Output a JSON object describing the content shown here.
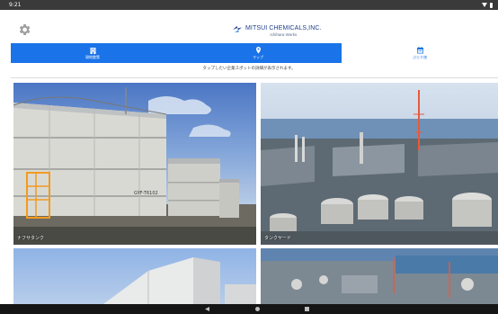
{
  "status_bar": {
    "time": "9:21"
  },
  "header": {
    "settings_icon": "gear-icon",
    "logo": {
      "name": "MITSUI CHEMICALS,INC.",
      "subtitle": "Ichihara Works",
      "icon": "mitsui-logo-icon"
    }
  },
  "tabs": [
    {
      "label": "現地散策",
      "icon": "building-icon",
      "active": true
    },
    {
      "label": "マップ",
      "icon": "map-pin-icon",
      "active": false
    },
    {
      "label": "ぶらり旅",
      "icon": "calendar-icon",
      "active": false
    }
  ],
  "colors": {
    "accent": "#1a73e8",
    "logo": "#1f3f8a"
  },
  "instruction": "タップしたい企業スポットの詳細が表示されます。",
  "tiles": [
    {
      "label": "ナフサタンク",
      "tank_text": "GYF-T6102"
    },
    {
      "label": "タンクヤード"
    },
    {
      "label": ""
    },
    {
      "label": ""
    }
  ]
}
